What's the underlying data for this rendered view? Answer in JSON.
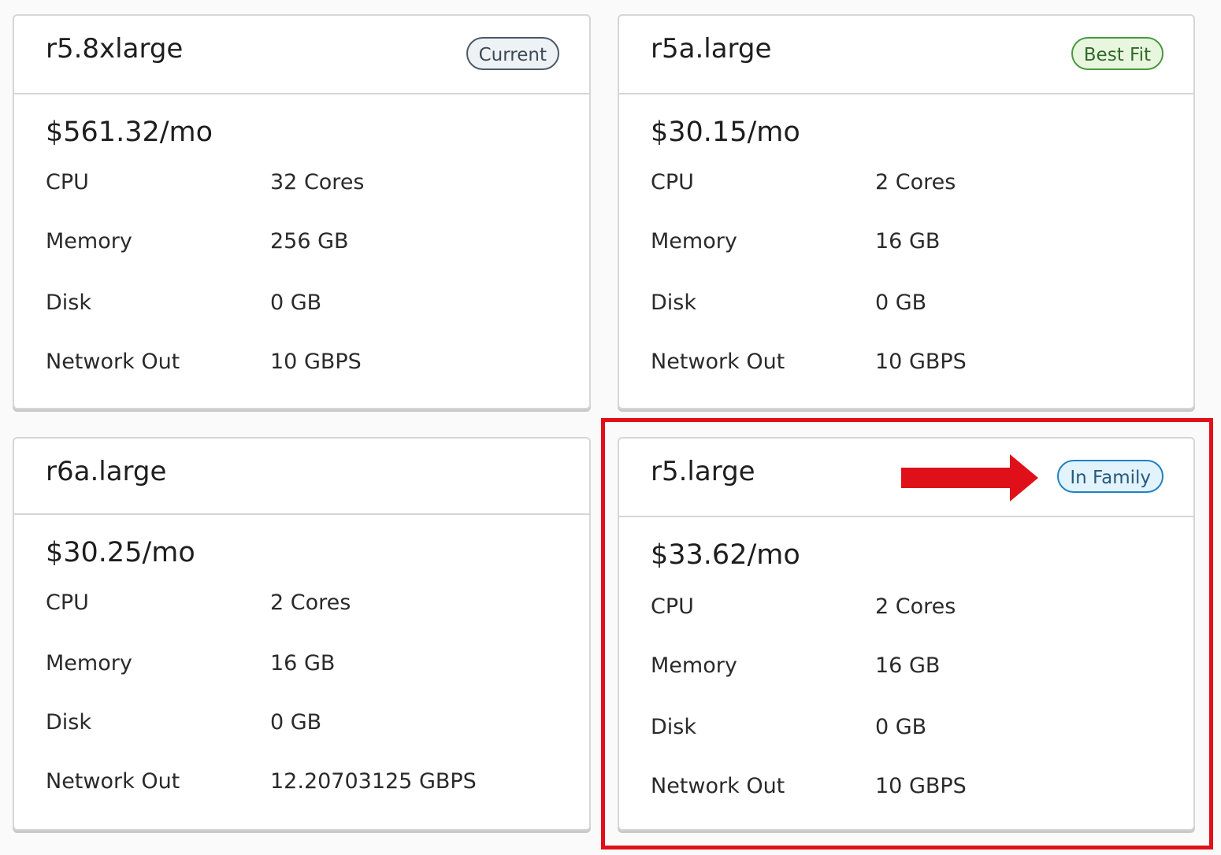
{
  "cards": [
    {
      "title": "r5.8xlarge",
      "badge": "Current",
      "price": "$561.32/mo",
      "specs": [
        {
          "label": "CPU",
          "value": "32 Cores"
        },
        {
          "label": "Memory",
          "value": "256 GB"
        },
        {
          "label": "Disk",
          "value": "0 GB"
        },
        {
          "label": "Network Out",
          "value": "10 GBPS"
        }
      ]
    },
    {
      "title": "r5a.large",
      "badge": "Best Fit",
      "price": "$30.15/mo",
      "specs": [
        {
          "label": "CPU",
          "value": "2 Cores"
        },
        {
          "label": "Memory",
          "value": "16 GB"
        },
        {
          "label": "Disk",
          "value": "0 GB"
        },
        {
          "label": "Network Out",
          "value": "10 GBPS"
        }
      ]
    },
    {
      "title": "r6a.large",
      "badge": "",
      "price": "$30.25/mo",
      "specs": [
        {
          "label": "CPU",
          "value": "2 Cores"
        },
        {
          "label": "Memory",
          "value": "16 GB"
        },
        {
          "label": "Disk",
          "value": "0 GB"
        },
        {
          "label": "Network Out",
          "value": "12.20703125 GBPS"
        }
      ]
    },
    {
      "title": "r5.large",
      "badge": "In Family",
      "price": "$33.62/mo",
      "specs": [
        {
          "label": "CPU",
          "value": "2 Cores"
        },
        {
          "label": "Memory",
          "value": "16 GB"
        },
        {
          "label": "Disk",
          "value": "0 GB"
        },
        {
          "label": "Network Out",
          "value": "10 GBPS"
        }
      ]
    }
  ],
  "colors": {
    "annotation": "#e0101a",
    "badge_current": "#4b5a68",
    "badge_best_fit": "#4a9a3f",
    "badge_in_family": "#1f82c2"
  },
  "annotation": {
    "arrow_icon": "right-arrow-icon",
    "highlight": "red-highlight-box"
  }
}
